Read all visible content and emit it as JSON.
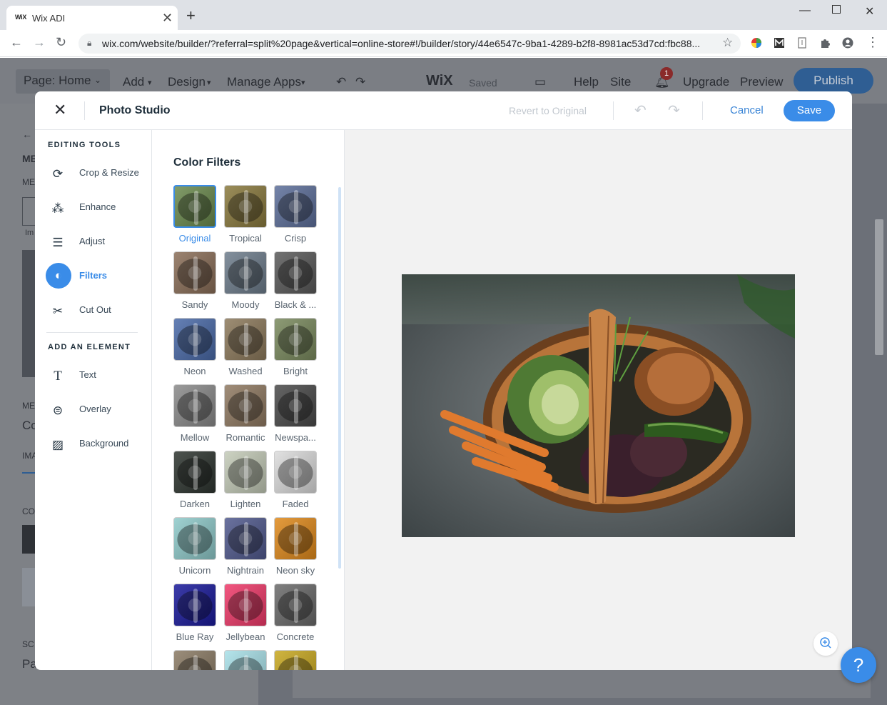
{
  "browser": {
    "tab_favicon": "WiX",
    "tab_title": "Wix ADI",
    "url": "wix.com/website/builder/?referral=split%20page&vertical=online-store#!/builder/story/44e6547c-9ba1-4289-b2f8-8981ac53d7cd:fbc88..."
  },
  "editor": {
    "page_select": "Page: Home",
    "menu": [
      "Add",
      "Design",
      "Manage Apps"
    ],
    "logo": "WiX",
    "saved_status": "Saved",
    "help": "Help",
    "site": "Site",
    "notification_count": "1",
    "upgrade": "Upgrade",
    "preview": "Preview",
    "publish": "Publish",
    "left_fragments": [
      "ME",
      "ME",
      "Im",
      "ME",
      "Co",
      "IMA",
      "CO",
      "SC",
      "Pa"
    ]
  },
  "photo_studio": {
    "title": "Photo Studio",
    "revert": "Revert to Original",
    "cancel": "Cancel",
    "save": "Save",
    "editing_tools_title": "EDITING TOOLS",
    "editing_tools": [
      {
        "label": "Crop & Resize",
        "icon": "crop-icon",
        "active": false
      },
      {
        "label": "Enhance",
        "icon": "magic-wand-icon",
        "active": false
      },
      {
        "label": "Adjust",
        "icon": "sliders-icon",
        "active": false
      },
      {
        "label": "Filters",
        "icon": "filters-icon",
        "active": true
      },
      {
        "label": "Cut Out",
        "icon": "scissors-icon",
        "active": false
      }
    ],
    "add_element_title": "ADD AN ELEMENT",
    "add_elements": [
      {
        "label": "Text",
        "icon": "text-icon"
      },
      {
        "label": "Overlay",
        "icon": "overlay-icon"
      },
      {
        "label": "Background",
        "icon": "background-icon"
      }
    ],
    "filters_title": "Color Filters",
    "filters": [
      {
        "name": "Original",
        "selected": true,
        "tint": "#6b8a4e"
      },
      {
        "name": "Tropical",
        "selected": false,
        "tint": "#8a7a3e"
      },
      {
        "name": "Crisp",
        "selected": false,
        "tint": "#5d6f9a"
      },
      {
        "name": "Sandy",
        "selected": false,
        "tint": "#8a6e58"
      },
      {
        "name": "Moody",
        "selected": false,
        "tint": "#6e7d8c"
      },
      {
        "name": "Black & ...",
        "selected": false,
        "tint": "#5a5a5a"
      },
      {
        "name": "Neon",
        "selected": false,
        "tint": "#4a6aa8"
      },
      {
        "name": "Washed",
        "selected": false,
        "tint": "#8d7a5c"
      },
      {
        "name": "Bright",
        "selected": false,
        "tint": "#7a8a5e"
      },
      {
        "name": "Mellow",
        "selected": false,
        "tint": "#8a8a8a"
      },
      {
        "name": "Romantic",
        "selected": false,
        "tint": "#907a62"
      },
      {
        "name": "Newspa...",
        "selected": false,
        "tint": "#4a4a4a"
      },
      {
        "name": "Darken",
        "selected": false,
        "tint": "#2e3530"
      },
      {
        "name": "Lighten",
        "selected": false,
        "tint": "#c4cbb8"
      },
      {
        "name": "Faded",
        "selected": false,
        "tint": "#dcdcdc"
      },
      {
        "name": "Unicorn",
        "selected": false,
        "tint": "#8fcaca"
      },
      {
        "name": "Nightrain",
        "selected": false,
        "tint": "#515a8e"
      },
      {
        "name": "Neon sky",
        "selected": false,
        "tint": "#e08a1c"
      },
      {
        "name": "Blue Ray",
        "selected": false,
        "tint": "#1a1a9a"
      },
      {
        "name": "Jellybean",
        "selected": false,
        "tint": "#f03a6a"
      },
      {
        "name": "Concrete",
        "selected": false,
        "tint": "#6a6a6a"
      },
      {
        "name": "",
        "selected": false,
        "tint": "#8a7a64"
      },
      {
        "name": "",
        "selected": false,
        "tint": "#a8e0e8"
      },
      {
        "name": "",
        "selected": false,
        "tint": "#c8a820"
      }
    ],
    "colors": {
      "accent": "#3a8ce8",
      "text": "#20303c"
    }
  }
}
